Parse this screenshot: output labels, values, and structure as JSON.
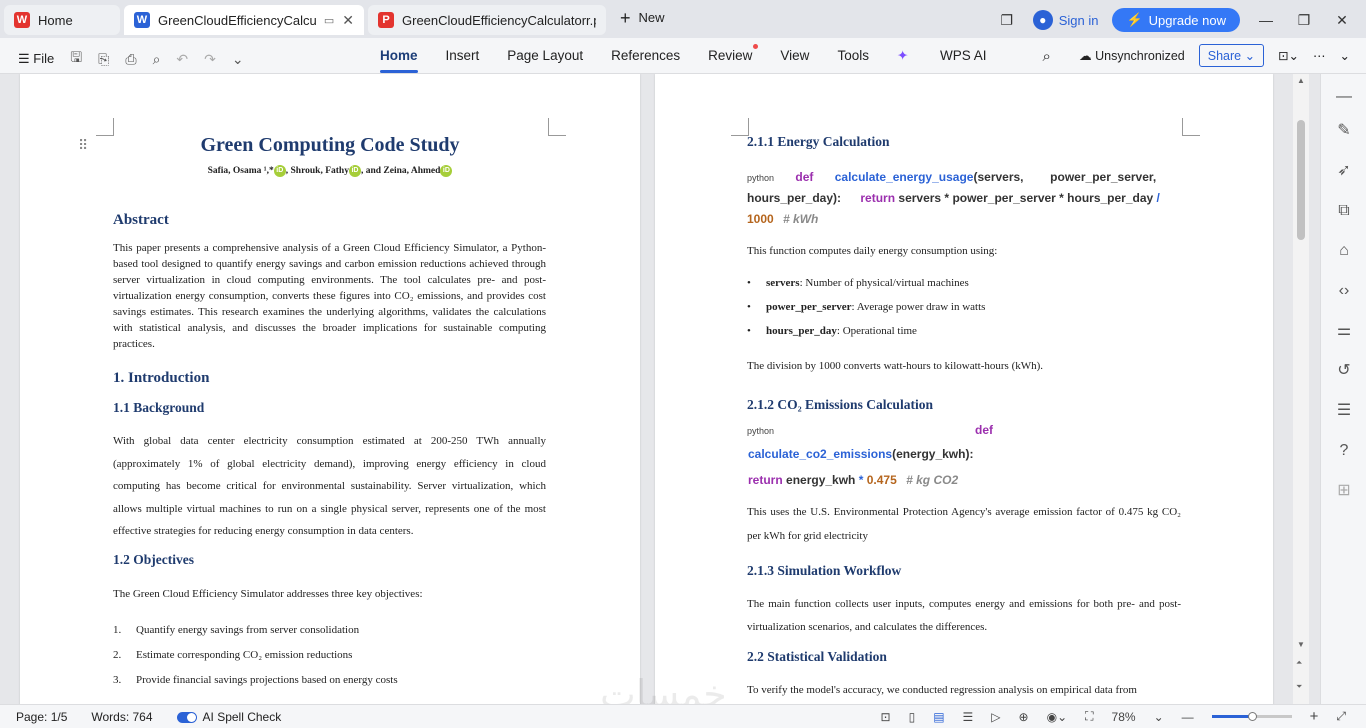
{
  "tabs": {
    "home": "Home",
    "doc_active": "GreenCloudEfficiencyCalcula",
    "doc_pdf": "GreenCloudEfficiencyCalculatorr.pd",
    "new": "New"
  },
  "titlebar": {
    "sign_in": "Sign in",
    "upgrade": "Upgrade now"
  },
  "ribbon": {
    "file": "File",
    "menus": [
      "Home",
      "Insert",
      "Page Layout",
      "References",
      "Review",
      "View",
      "Tools",
      "WPS AI"
    ],
    "sync": "Unsynchronized",
    "share": "Share"
  },
  "page1": {
    "title": "Green Computing Code Study",
    "authors": "Safia, Osama ¹,*",
    "authors_2": ", Shrouk, Fathy",
    "authors_3": ", and Zeina, Ahmed",
    "abstract_h": "Abstract",
    "abstract": "This paper presents a comprehensive analysis of a Green Cloud Efficiency Simulator, a Python-based tool designed to quantify energy savings and carbon emission reductions achieved through server virtualization in cloud computing environments. The tool calculates pre- and post-virtualization energy consumption, converts these figures into CO₂ emissions, and provides cost savings estimates. This research examines the underlying algorithms, validates the calculations with statistical analysis, and discusses the broader implications for sustainable computing practices.",
    "intro_h": "1. Introduction",
    "bg_h": "1.1 Background",
    "bg": "With global data center electricity consumption estimated at 200-250 TWh annually (approximately 1% of global electricity demand), improving energy efficiency in cloud computing has become critical for environmental sustainability. Server virtualization, which allows multiple virtual machines to run on a single physical server, represents one of the most effective strategies for reducing energy consumption in data centers.",
    "obj_h": "1.2 Objectives",
    "obj": "The Green Cloud Efficiency Simulator addresses three key objectives:",
    "list": [
      {
        "n": "1.",
        "t": "Quantify energy savings from server consolidation"
      },
      {
        "n": "2.",
        "t": "Estimate corresponding CO₂ emission reductions"
      },
      {
        "n": "3.",
        "t": "Provide financial savings projections based on energy costs"
      }
    ]
  },
  "page2": {
    "h211": "2.1.1 Energy Calculation",
    "code1": {
      "lang": "python",
      "kw_def": "def",
      "fn": "calculate_energy_usage",
      "args": "(servers,        power_per_server,",
      "line2a": "hours_per_day):",
      "kw_ret": "return",
      "expr": "servers * power_per_server * hours_per_day",
      "op": "/",
      "num": "1000",
      "cm": "# kWh"
    },
    "p1": "This function computes daily energy consumption using:",
    "bullets": [
      {
        "b": "servers",
        "t": ": Number of physical/virtual machines"
      },
      {
        "b": "power_per_server",
        "t": ": Average power draw in watts"
      },
      {
        "b": "hours_per_day",
        "t": ": Operational time"
      }
    ],
    "p2": "The division by 1000 converts watt-hours to kilowatt-hours (kWh).",
    "h212": "2.1.2 CO₂ Emissions Calculation",
    "code2": {
      "lang": "python",
      "kw_def": "def",
      "fn": "calculate_co2_emissions",
      "args": "(energy_kwh):",
      "kw_ret": "return",
      "expr": "energy_kwh",
      "op": "*",
      "num": "0.475",
      "cm": "# kg CO2"
    },
    "p3": "This uses the U.S. Environmental Protection Agency's average emission factor of 0.475 kg CO₂ per kWh for grid electricity",
    "h213": "2.1.3 Simulation Workflow",
    "p4": "The main function collects user inputs, computes energy and emissions for both pre- and post-virtualization scenarios, and calculates the differences.",
    "h22": "2.2 Statistical Validation",
    "p5": "To verify the model's accuracy, we conducted regression analysis on empirical data from"
  },
  "status": {
    "page": "Page: 1/5",
    "words": "Words: 764",
    "spell": "AI Spell Check",
    "zoom": "78%"
  },
  "watermark": "خمسات",
  "colors": {
    "accent": "#2b62d6",
    "heading": "#1f3b6e",
    "keyword": "#9b2fae"
  }
}
